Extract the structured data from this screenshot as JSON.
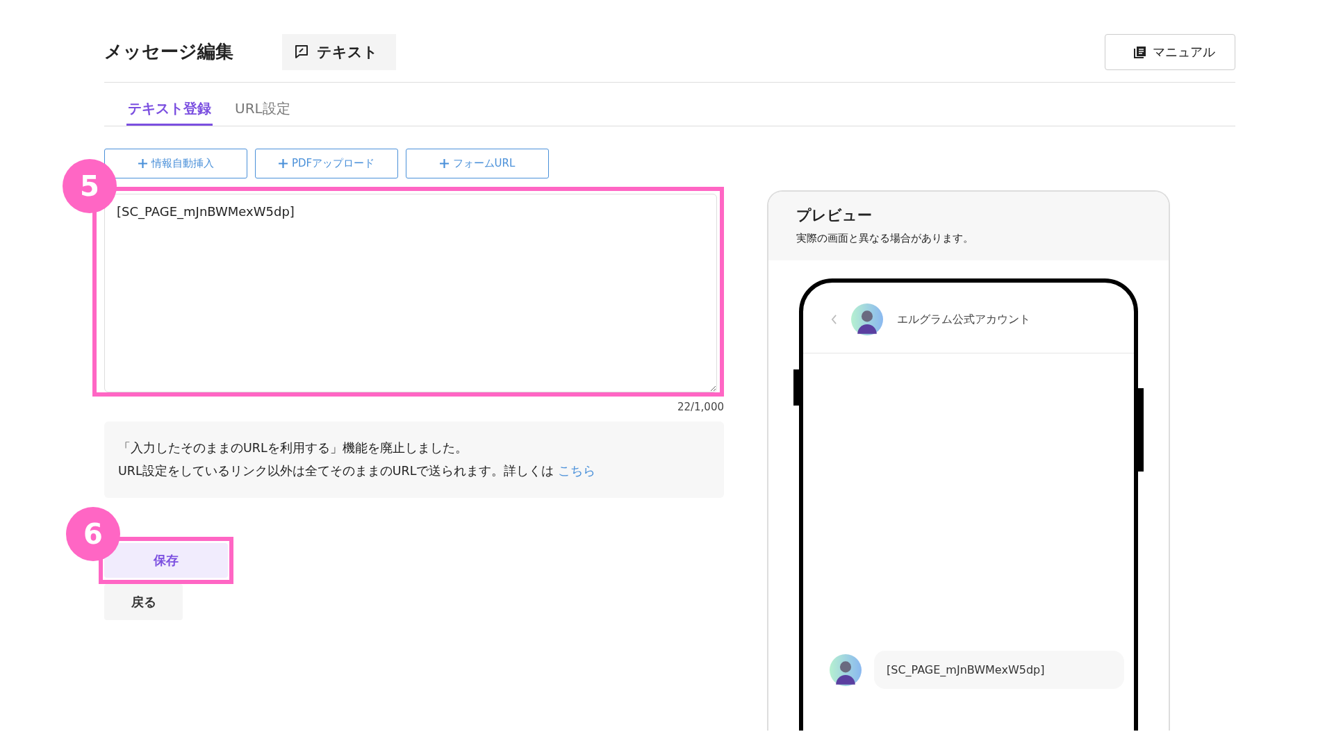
{
  "header": {
    "title": "メッセージ編集",
    "type_chip": "テキスト",
    "manual_button": "マニュアル"
  },
  "tabs": [
    {
      "label": "テキスト登録",
      "selected": true
    },
    {
      "label": "URL設定",
      "selected": false
    }
  ],
  "insert_buttons": [
    "情報自動挿入",
    "PDFアップロード",
    "フォームURL"
  ],
  "editor": {
    "value": "[SC_PAGE_mJnBWMexW5dp]",
    "counter": "22/1,000"
  },
  "notice": {
    "line1": "「入力したそのままのURLを利用する」機能を廃止しました。",
    "line2": "URL設定をしているリンク以外は全てそのままのURLで送られます。詳しくは",
    "link": "こちら"
  },
  "actions": {
    "save": "保存",
    "back": "戻る"
  },
  "annotations": [
    {
      "number": "5"
    },
    {
      "number": "6"
    }
  ],
  "preview": {
    "title": "プレビュー",
    "note": "実際の画面と異なる場合があります。",
    "account_name": "エルグラム公式アカウント",
    "message": "[SC_PAGE_mJnBWMexW5dp]"
  }
}
